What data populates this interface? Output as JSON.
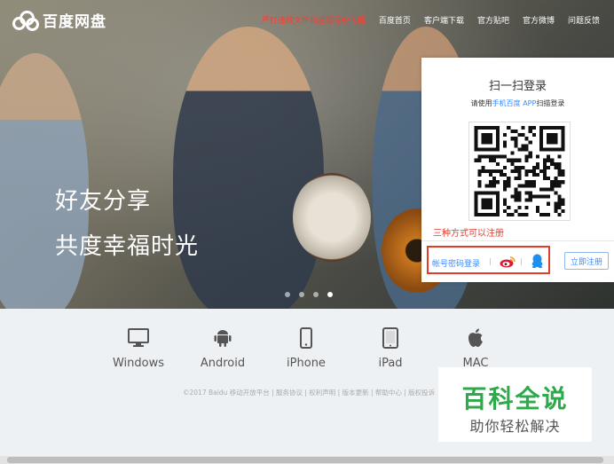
{
  "header": {
    "logo_text": "百度网盘",
    "nav": [
      {
        "label": "严打违规文件和盗版侵权传播",
        "warn": true
      },
      {
        "label": "百度首页"
      },
      {
        "label": "客户端下载"
      },
      {
        "label": "官方贴吧"
      },
      {
        "label": "官方微博"
      },
      {
        "label": "问题反馈"
      }
    ]
  },
  "hero": {
    "slogan_line1": "好友分享",
    "slogan_line2": "共度幸福时光",
    "carousel_dots": 4,
    "active_dot": 4
  },
  "login": {
    "title": "扫一扫登录",
    "hint_prefix": "请使用",
    "hint_link": "手机百度 APP",
    "hint_suffix": "扫描登录",
    "register_tip": "三种方式可以注册",
    "account_login": "帐号密码登录",
    "register_button": "立即注册"
  },
  "platforms": [
    {
      "label": "Windows",
      "icon": "monitor-icon"
    },
    {
      "label": "Android",
      "icon": "android-icon"
    },
    {
      "label": "iPhone",
      "icon": "iphone-icon"
    },
    {
      "label": "iPad",
      "icon": "ipad-icon"
    },
    {
      "label": "MAC",
      "icon": "apple-icon"
    }
  ],
  "footer": {
    "copyright": "©2017 Baidu 移动开放平台 | 服务协议 | 权利声明 | 版本更新 | 帮助中心 | 版权投诉"
  },
  "watermark": {
    "title": "百科全说",
    "subtitle": "助你轻松解决"
  },
  "colors": {
    "warn_red": "#ff3b30",
    "link_blue": "#3b8cff",
    "tip_red": "#e43c2b",
    "watermark_green": "#2daa4a"
  }
}
